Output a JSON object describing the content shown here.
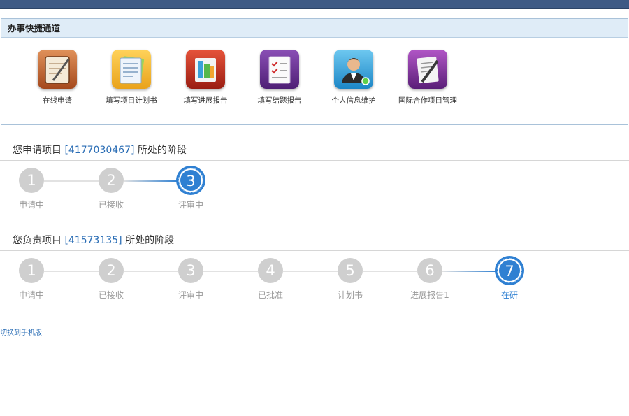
{
  "quick": {
    "title": "办事快捷通道",
    "items": [
      {
        "label": "在线申请",
        "icon": "notebook-pen-icon"
      },
      {
        "label": "填写项目计划书",
        "icon": "folder-document-icon"
      },
      {
        "label": "填写进展报告",
        "icon": "report-books-icon"
      },
      {
        "label": "填写结题报告",
        "icon": "checklist-icon"
      },
      {
        "label": "个人信息维护",
        "icon": "user-profile-icon"
      },
      {
        "label": "国际合作项目管理",
        "icon": "document-pen-icon"
      }
    ]
  },
  "apply": {
    "prefix": "您申请项目 ",
    "project_id": "[4177030467]",
    "suffix": " 所处的阶段",
    "steps": [
      {
        "num": "1",
        "label": "申请中"
      },
      {
        "num": "2",
        "label": "已接收"
      },
      {
        "num": "3",
        "label": "评审中"
      }
    ],
    "current_step": 3
  },
  "charge": {
    "prefix": "您负责项目 ",
    "project_id": "[41573135]",
    "suffix": " 所处的阶段",
    "steps": [
      {
        "num": "1",
        "label": "申请中"
      },
      {
        "num": "2",
        "label": "已接收"
      },
      {
        "num": "3",
        "label": "评审中"
      },
      {
        "num": "4",
        "label": "已批准"
      },
      {
        "num": "5",
        "label": "计划书"
      },
      {
        "num": "6",
        "label": "进展报告1"
      },
      {
        "num": "7",
        "label": "在研"
      }
    ],
    "current_step": 7
  },
  "footer": {
    "mobile_link": "切换到手机版"
  },
  "colors": {
    "accent": "#2f80d2",
    "inactive": "#cfcfcf",
    "topbar": "#3e5a85",
    "panel_header": "#dfecf7"
  }
}
